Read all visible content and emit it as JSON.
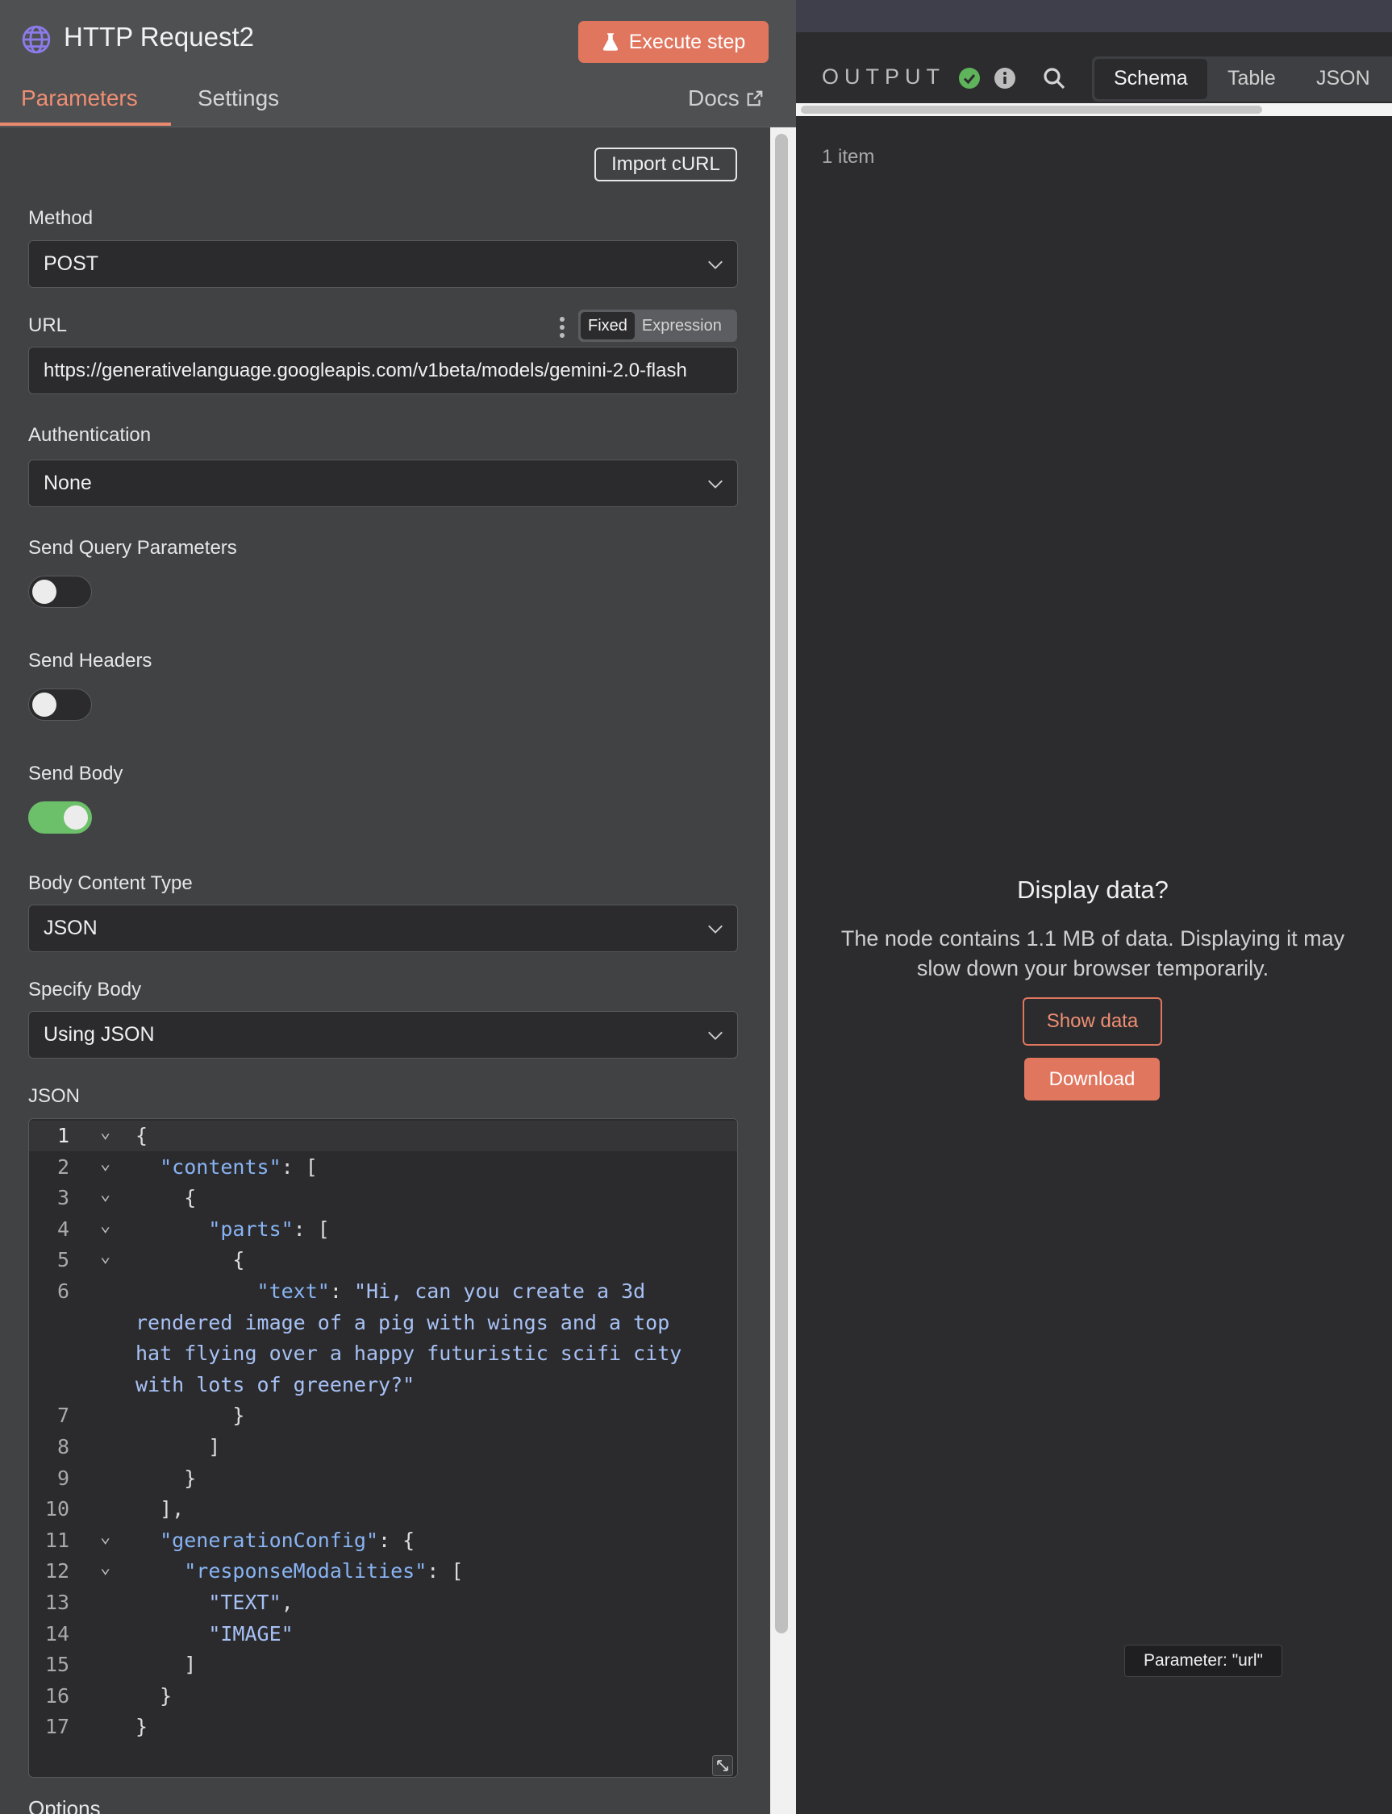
{
  "node": {
    "title": "HTTP Request2",
    "icon": "globe-icon"
  },
  "toolbar": {
    "execute_label": "Execute step"
  },
  "tabs": [
    {
      "label": "Parameters",
      "active": true
    },
    {
      "label": "Settings",
      "active": false
    }
  ],
  "docs_label": "Docs",
  "import_curl_label": "Import cURL",
  "method": {
    "label": "Method",
    "value": "POST"
  },
  "url": {
    "label": "URL",
    "value": "https://generativelanguage.googleapis.com/v1beta/models/gemini-2.0-flash",
    "modes": [
      "Fixed",
      "Expression"
    ],
    "active_mode": "Fixed"
  },
  "authentication": {
    "label": "Authentication",
    "value": "None"
  },
  "send_query": {
    "label": "Send Query Parameters",
    "enabled": false
  },
  "send_headers": {
    "label": "Send Headers",
    "enabled": false
  },
  "send_body": {
    "label": "Send Body",
    "enabled": true
  },
  "body_content_type": {
    "label": "Body Content Type",
    "value": "JSON"
  },
  "specify_body": {
    "label": "Specify Body",
    "value": "Using JSON"
  },
  "json_editor": {
    "label": "JSON",
    "lines": [
      {
        "n": "1",
        "fold": true,
        "text": "{"
      },
      {
        "n": "2",
        "fold": true,
        "text": "  \"contents\": ["
      },
      {
        "n": "3",
        "fold": true,
        "text": "    {"
      },
      {
        "n": "4",
        "fold": true,
        "text": "      \"parts\": ["
      },
      {
        "n": "5",
        "fold": true,
        "text": "        {"
      },
      {
        "n": "6",
        "fold": false,
        "text": "          \"text\": \"Hi, can you create a 3d"
      },
      {
        "n": "",
        "fold": false,
        "text": "rendered image of a pig with wings and a top"
      },
      {
        "n": "",
        "fold": false,
        "text": "hat flying over a happy futuristic scifi city"
      },
      {
        "n": "",
        "fold": false,
        "text": "with lots of greenery?\""
      },
      {
        "n": "7",
        "fold": false,
        "text": "        }"
      },
      {
        "n": "8",
        "fold": false,
        "text": "      ]"
      },
      {
        "n": "9",
        "fold": false,
        "text": "    }"
      },
      {
        "n": "10",
        "fold": false,
        "text": "  ],"
      },
      {
        "n": "11",
        "fold": true,
        "text": "  \"generationConfig\": {"
      },
      {
        "n": "12",
        "fold": true,
        "text": "    \"responseModalities\": ["
      },
      {
        "n": "13",
        "fold": false,
        "text": "      \"TEXT\","
      },
      {
        "n": "14",
        "fold": false,
        "text": "      \"IMAGE\""
      },
      {
        "n": "15",
        "fold": false,
        "text": "    ]"
      },
      {
        "n": "16",
        "fold": false,
        "text": "  }"
      },
      {
        "n": "17",
        "fold": false,
        "text": "}"
      }
    ]
  },
  "options_label": "Options",
  "output": {
    "title": "OUTPUT",
    "views": [
      "Schema",
      "Table",
      "JSON"
    ],
    "active_view": "Schema",
    "item_count": "1 item",
    "display_title": "Display data?",
    "display_text": "The node contains 1.1 MB of data. Displaying it may slow down your browser temporarily.",
    "show_data_label": "Show data",
    "download_label": "Download"
  },
  "tooltip": "Parameter: \"url\"",
  "colors": {
    "accent": "#e1765f",
    "tab_active": "#ef8e73",
    "toggle_on": "#6bc069",
    "success": "#5fb35a",
    "json_key": "#88b4f4",
    "json_string": "#a7c1f5"
  }
}
